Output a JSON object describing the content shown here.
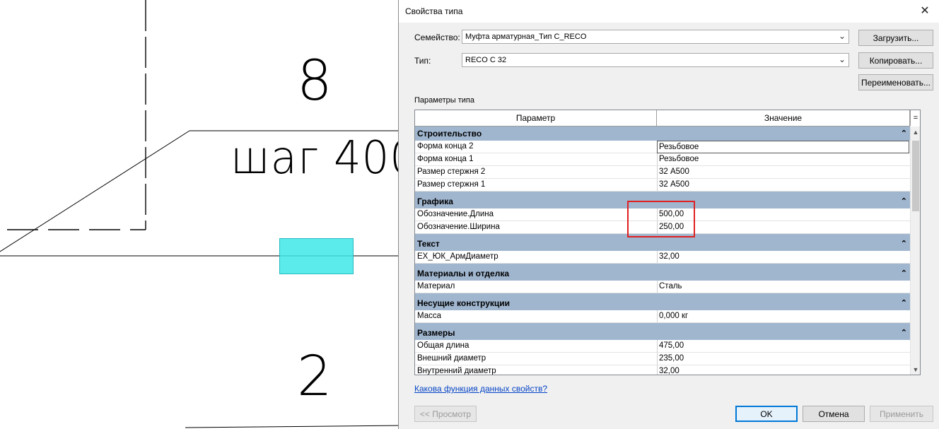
{
  "cad": {
    "label_top": "8",
    "label_step": "шаг 400",
    "label_bottom": "2"
  },
  "dialog": {
    "title": "Свойства типа",
    "close_glyph": "✕",
    "family_label": "Семейство:",
    "family_value": "Муфта арматурная_Тип C_RECO",
    "type_label": "Тип:",
    "type_value": "RECO C 32",
    "buttons": {
      "load": "Загрузить...",
      "copy": "Копировать...",
      "rename": "Переименовать...",
      "preview": "<< Просмотр",
      "ok": "OK",
      "cancel": "Отмена",
      "apply": "Применить"
    },
    "section_label": "Параметры типа",
    "grid_header": {
      "param": "Параметр",
      "value": "Значение",
      "sort_glyph": "="
    },
    "help_link": "Какова функция данных свойств?"
  },
  "groups": [
    {
      "name": "Строительство",
      "rows": [
        {
          "param": "Форма конца 2",
          "value": "Резьбовое"
        },
        {
          "param": "Форма конца 1",
          "value": "Резьбовое"
        },
        {
          "param": "Размер стержня 2",
          "value": "32 А500"
        },
        {
          "param": "Размер стержня 1",
          "value": "32 А500"
        }
      ]
    },
    {
      "name": "Графика",
      "rows": [
        {
          "param": "Обозначение.Длина",
          "value": "500,00"
        },
        {
          "param": "Обозначение.Ширина",
          "value": "250,00"
        }
      ]
    },
    {
      "name": "Текст",
      "rows": [
        {
          "param": "EX_ЮК_АрмДиаметр",
          "value": "32,00"
        }
      ]
    },
    {
      "name": "Материалы и отделка",
      "rows": [
        {
          "param": "Материал",
          "value": "Сталь"
        }
      ]
    },
    {
      "name": "Несущие конструкции",
      "rows": [
        {
          "param": "Масса",
          "value": "0,000 кг"
        }
      ]
    },
    {
      "name": "Размеры",
      "rows": [
        {
          "param": "Общая длина",
          "value": "475,00"
        },
        {
          "param": "Внешний диаметр",
          "value": "235,00"
        },
        {
          "param": "Внутренний диаметр",
          "value": "32,00"
        }
      ]
    }
  ],
  "colors": {
    "group_header_bg": "#a0b6cf",
    "highlight_cyan": "#40e8e8",
    "annotation_red": "#e02020",
    "link_blue": "#0645c6"
  }
}
